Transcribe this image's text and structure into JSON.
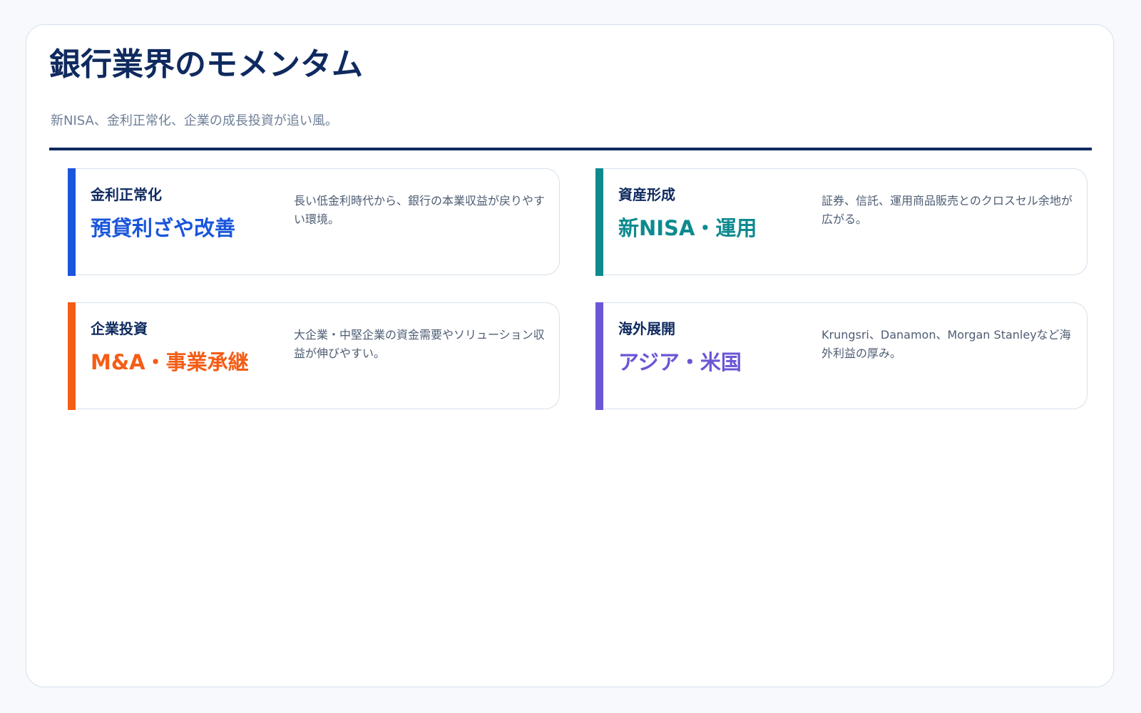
{
  "header": {
    "title": "銀行業界のモメンタム",
    "subtitle": "新NISA、金利正常化、企業の成長投資が追い風。"
  },
  "colors": {
    "navy": "#0f2a5f",
    "blue": "#1a56db",
    "teal": "#0e8a8e",
    "orange": "#f45d16",
    "purple": "#6b57d6"
  },
  "cards": [
    {
      "label": "金利正常化",
      "headline": "預貸利ざや改善",
      "description": "長い低金利時代から、銀行の本業収益が戻りやすい環境。",
      "accent": "#1a56db"
    },
    {
      "label": "資産形成",
      "headline": "新NISA・運用",
      "description": "証券、信託、運用商品販売とのクロスセル余地が広がる。",
      "accent": "#0e8a8e"
    },
    {
      "label": "企業投資",
      "headline": "M&A・事業承継",
      "description": "大企業・中堅企業の資金需要やソリューション収益が伸びやすい。",
      "accent": "#f45d16"
    },
    {
      "label": "海外展開",
      "headline": "アジア・米国",
      "description": "Krungsri、Danamon、Morgan Stanleyなど海外利益の厚み。",
      "accent": "#6b57d6"
    }
  ]
}
